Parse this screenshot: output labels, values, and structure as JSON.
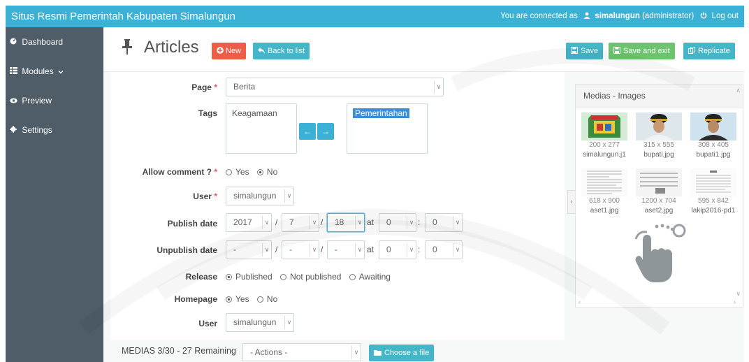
{
  "topbar": {
    "title": "Situs Resmi Pemerintah Kabupaten Simalungun",
    "connected_prefix": "You are connected as",
    "user": "simalungun",
    "role": "(administrator)",
    "logout": "Log out"
  },
  "sidebar": {
    "items": [
      {
        "label": "Dashboard",
        "icon": "dashboard-icon"
      },
      {
        "label": "Modules",
        "icon": "grid-icon"
      },
      {
        "label": "Preview",
        "icon": "eye-icon"
      },
      {
        "label": "Settings",
        "icon": "gear-icon"
      }
    ]
  },
  "header": {
    "title": "Articles",
    "new_label": "New",
    "back_label": "Back to list",
    "save_label": "Save",
    "save_exit_label": "Save and exit",
    "replicate_label": "Replicate"
  },
  "form": {
    "page": {
      "label": "Page",
      "value": "Berita"
    },
    "tags": {
      "label": "Tags",
      "available": [
        "Keagamaan"
      ],
      "selected": [
        "Pemerintahan"
      ]
    },
    "allow_comment": {
      "label": "Allow comment ?",
      "yes": "Yes",
      "no": "No",
      "value": "No"
    },
    "user": {
      "label": "User",
      "value": "simalungun"
    },
    "publish_date": {
      "label": "Publish date",
      "year": "2017",
      "month": "7",
      "day": "18",
      "at": "at",
      "hour": "0",
      "minute": "0"
    },
    "unpublish_date": {
      "label": "Unpublish date",
      "year": "-",
      "month": "-",
      "day": "-",
      "at": "at",
      "hour": "0",
      "minute": "0"
    },
    "release": {
      "label": "Release",
      "options": [
        "Published",
        "Not published",
        "Awaiting"
      ],
      "value": "Published"
    },
    "homepage": {
      "label": "Homepage",
      "yes": "Yes",
      "no": "No",
      "value": "Yes"
    },
    "user2": {
      "label": "User",
      "value": "simalungun"
    },
    "required_mark": "*",
    "slash": "/",
    "colon": ":"
  },
  "medias": {
    "label": "MEDIAS  3/30 - 27 Remaining",
    "actions_placeholder": "- Actions -",
    "choose_label": "Choose a file"
  },
  "media_panel": {
    "title": "Medias - Images",
    "images": [
      {
        "dims": "200 x 277",
        "name": "simalungun.j1"
      },
      {
        "dims": "315 x 555",
        "name": "bupati.jpg"
      },
      {
        "dims": "308 x 405",
        "name": "bupati1.jpg"
      },
      {
        "dims": "618 x 900",
        "name": "aset1.jpg"
      },
      {
        "dims": "1200 x 704",
        "name": "aset2.jpg"
      },
      {
        "dims": "595 x 842",
        "name": "lakip2016-pd1"
      }
    ]
  },
  "colors": {
    "topbar": "#3bb1d6",
    "sidebar": "#4e5d68",
    "new_button": "#ed5e48",
    "back_button": "#45b6c9",
    "save_button": "#45b6c9",
    "save_exit_button": "#6cc46e",
    "replicate_button": "#45b6c9"
  }
}
